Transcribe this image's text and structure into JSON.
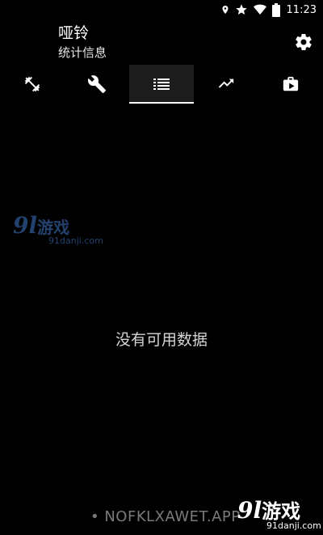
{
  "status_bar": {
    "time": "11:23",
    "icons": [
      "location-icon",
      "star-icon",
      "wifi-icon",
      "battery-icon"
    ]
  },
  "header": {
    "title": "哑铃",
    "subtitle": "统计信息"
  },
  "tabs": [
    {
      "icon": "dumbbell-icon",
      "active": false
    },
    {
      "icon": "wrench-icon",
      "active": false
    },
    {
      "icon": "list-icon",
      "active": true
    },
    {
      "icon": "trending-up-icon",
      "active": false
    },
    {
      "icon": "video-library-icon",
      "active": false
    }
  ],
  "content": {
    "empty_message": "没有可用数据"
  },
  "watermarks": {
    "logo_number": "9l",
    "logo_text": "游戏",
    "domain": "91danji.com"
  },
  "footer": {
    "url_text": "• NOFKLXAWET.APP"
  },
  "colors": {
    "background": "#000000",
    "tab_active_bg": "#1c1c1c",
    "indicator": "#ffffff"
  }
}
